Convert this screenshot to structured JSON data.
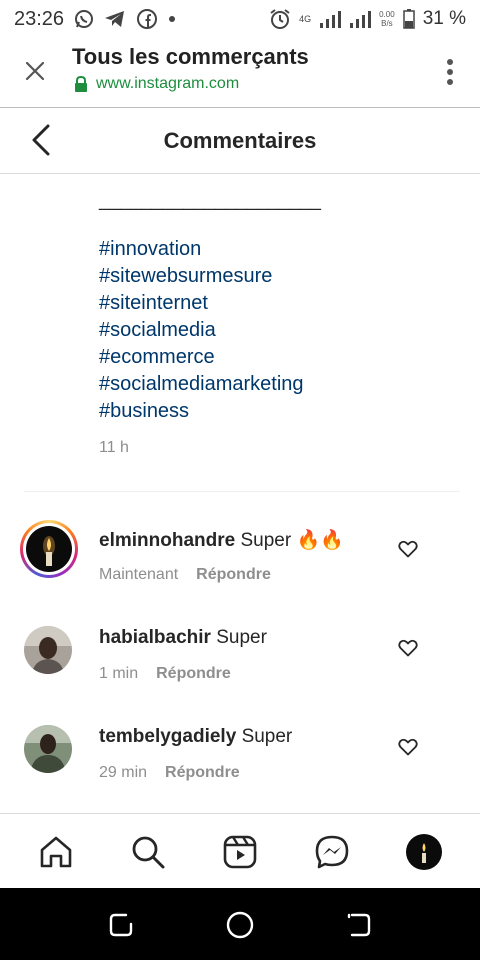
{
  "status_bar": {
    "time": "23:26",
    "network_type": "4G",
    "net_speed_value": "0.00",
    "net_speed_unit": "B/s",
    "battery": "31 %",
    "icons": [
      "whatsapp-icon",
      "telegram-icon",
      "facebook-icon",
      "dot-icon",
      "alarm-icon",
      "signal-icon",
      "signal-icon",
      "battery-icon"
    ]
  },
  "browser": {
    "title": "Tous les commerçants",
    "url": "www.instagram.com"
  },
  "header": {
    "title": "Commentaires"
  },
  "caption": {
    "divider": "_____________________",
    "hashtags": [
      "#innovation",
      "#sitewebsurmesure",
      "#siteinternet",
      "#socialmedia",
      "#ecommerce",
      "#socialmediamarketing",
      "#business"
    ],
    "time": "11 h"
  },
  "comments": [
    {
      "username": "elminnohandre",
      "text": "Super 🔥🔥",
      "time": "Maintenant",
      "reply": "Répondre"
    },
    {
      "username": "habialbachir",
      "text": "Super",
      "time": "1 min",
      "reply": "Répondre"
    },
    {
      "username": "tembelygadiely",
      "text": "Super",
      "time": "29 min",
      "reply": "Répondre"
    }
  ],
  "bottom_nav": [
    "home-icon",
    "search-icon",
    "reels-icon",
    "messenger-icon",
    "profile-avatar"
  ],
  "colors": {
    "hashtag": "#00376b",
    "secure_green": "#1e8e3e",
    "muted": "#8e8e8e"
  }
}
